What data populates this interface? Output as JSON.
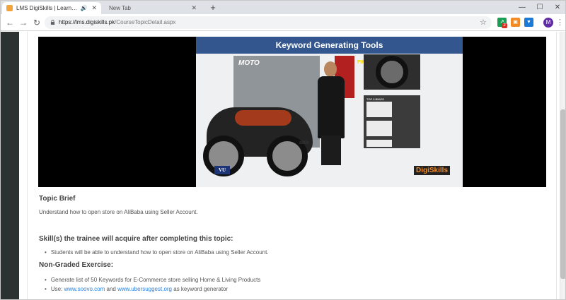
{
  "browser": {
    "active_tab_title": "LMS DigiSkills | Learning Ma",
    "inactive_tab_title": "New Tab",
    "new_tab_glyph": "+",
    "url_domain": "https://lms.digiskills.pk",
    "url_path": "/CourseTopicDetail.aspx",
    "extension_badge": "2",
    "profile_initial": "M"
  },
  "video": {
    "slide_title": "Keyword Generating Tools",
    "magazine_title": "MOTO",
    "first_rides": "FIRST RIDES",
    "top_bikes": "TOP 5 BIKES",
    "stray_text": "able",
    "vu_logo": "VU",
    "digiskills_logo_a": "Digi",
    "digiskills_logo_b": "Skills"
  },
  "content": {
    "topic_brief_heading": "Topic Brief",
    "topic_brief_text": "Understand how to open store on AliBaba using Seller Account.",
    "skills_heading": "Skill(s) the trainee will acquire after completing this topic:",
    "skills": [
      "Students will be able to understand how to open store on AliBaba using Seller Account."
    ],
    "exercise_heading": "Non-Graded Exercise:",
    "exercise_item_1": "Generate list of 50 Keywords for E-Commerce store selling Home & Living Products",
    "exercise_item_2_prefix": "Use: ",
    "exercise_link_1": "www.soovo.com",
    "exercise_item_2_mid": " and ",
    "exercise_link_2": "www.ubersuggest.org",
    "exercise_item_2_suffix": " as keyword generator"
  },
  "colors": {
    "slide_header": "#34568e",
    "link": "#2a7fe0",
    "sidebar": "#2c3131"
  }
}
